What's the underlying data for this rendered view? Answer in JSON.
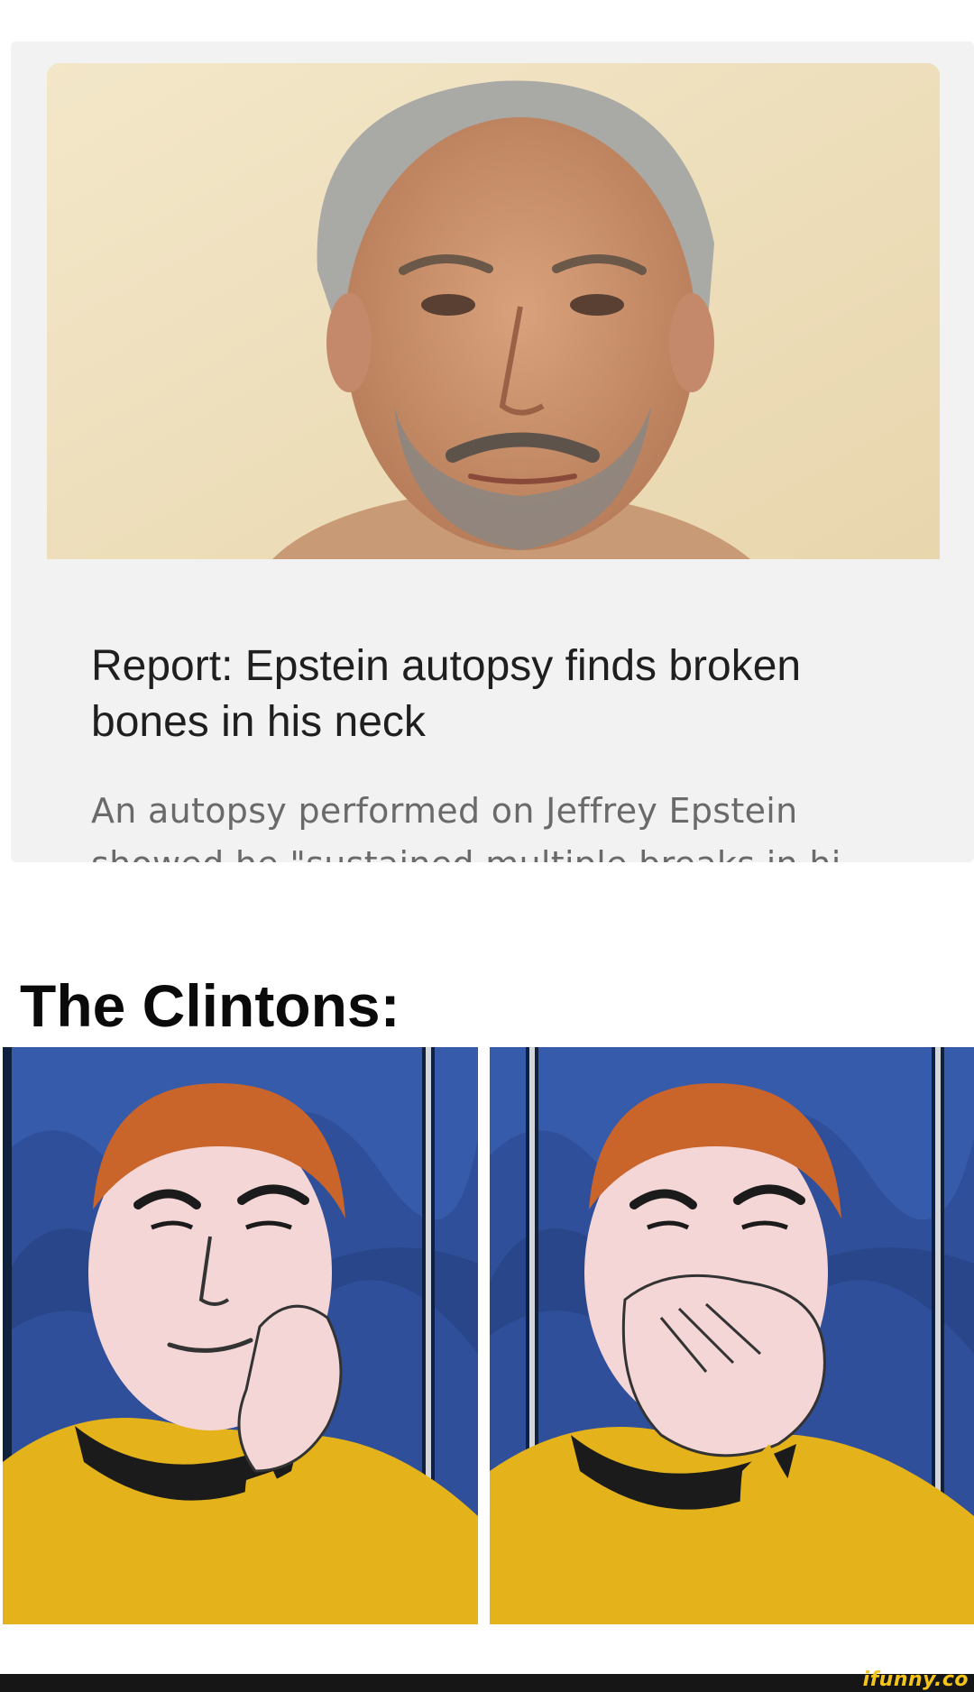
{
  "news_card": {
    "photo_icon": "portrait-photo",
    "headline": "Report: Epstein autopsy finds broken bones in his neck",
    "snippet": "An autopsy performed on Jeffrey Epstein showed he \"sustained multiple breaks in hi..."
  },
  "caption": {
    "text": "The Clintons:"
  },
  "panels": [
    {
      "icon": "cartoon-face-hand-on-cheek"
    },
    {
      "icon": "cartoon-face-hand-over-mouth"
    }
  ],
  "watermark": {
    "text": "ifunny.co"
  },
  "colors": {
    "card_background": "#f2f2f2",
    "headline": "#1f1f1f",
    "snippet": "#6a6a6a",
    "panel_background": "#2f4f9a",
    "shirt": "#e4b21a",
    "watermark": "#f3c51b"
  }
}
